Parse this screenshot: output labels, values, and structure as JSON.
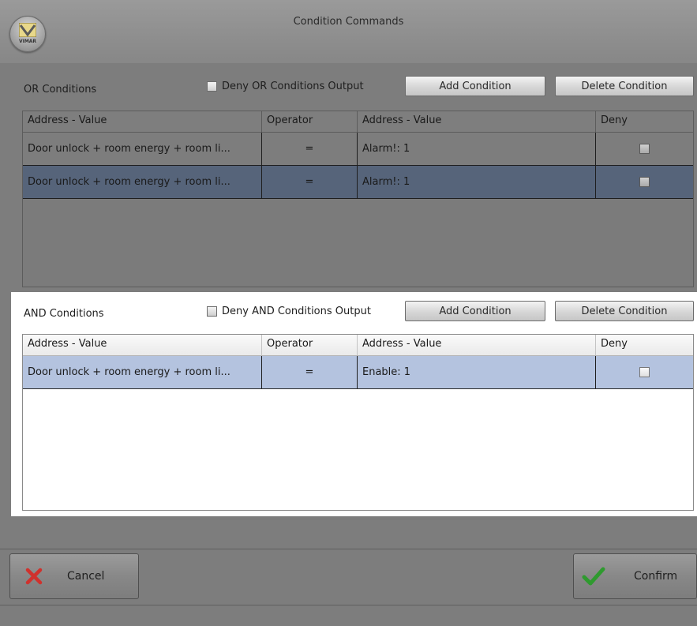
{
  "window": {
    "title": "Condition Commands",
    "logo_text": "VIMAR"
  },
  "or_section": {
    "label": "OR Conditions",
    "deny_label": "Deny OR Conditions Output",
    "add_label": "Add Condition",
    "delete_label": "Delete Condition",
    "columns": [
      "Address - Value",
      "Operator",
      "Address - Value",
      "Deny"
    ],
    "rows": [
      {
        "address": "Door unlock + room energy + room li...",
        "operator": "=",
        "value": "Alarm!: 1",
        "deny": false,
        "selected": false
      },
      {
        "address": "Door unlock + room energy + room li...",
        "operator": "=",
        "value": "Alarm!: 1",
        "deny": false,
        "selected": true
      }
    ]
  },
  "and_section": {
    "label": "AND Conditions",
    "deny_label": "Deny AND Conditions Output",
    "add_label": "Add Condition",
    "delete_label": "Delete Condition",
    "columns": [
      "Address - Value",
      "Operator",
      "Address - Value",
      "Deny"
    ],
    "rows": [
      {
        "address": "Door unlock + room energy + room li...",
        "operator": "=",
        "value": "Enable: 1",
        "deny": false,
        "selected": true
      }
    ]
  },
  "footer": {
    "cancel_label": "Cancel",
    "confirm_label": "Confirm"
  },
  "colors": {
    "cancel_icon": "#d0312d",
    "confirm_icon": "#2f9a2f",
    "selected_row_dark": "#56647a",
    "selected_row_light": "#b4c3df"
  }
}
